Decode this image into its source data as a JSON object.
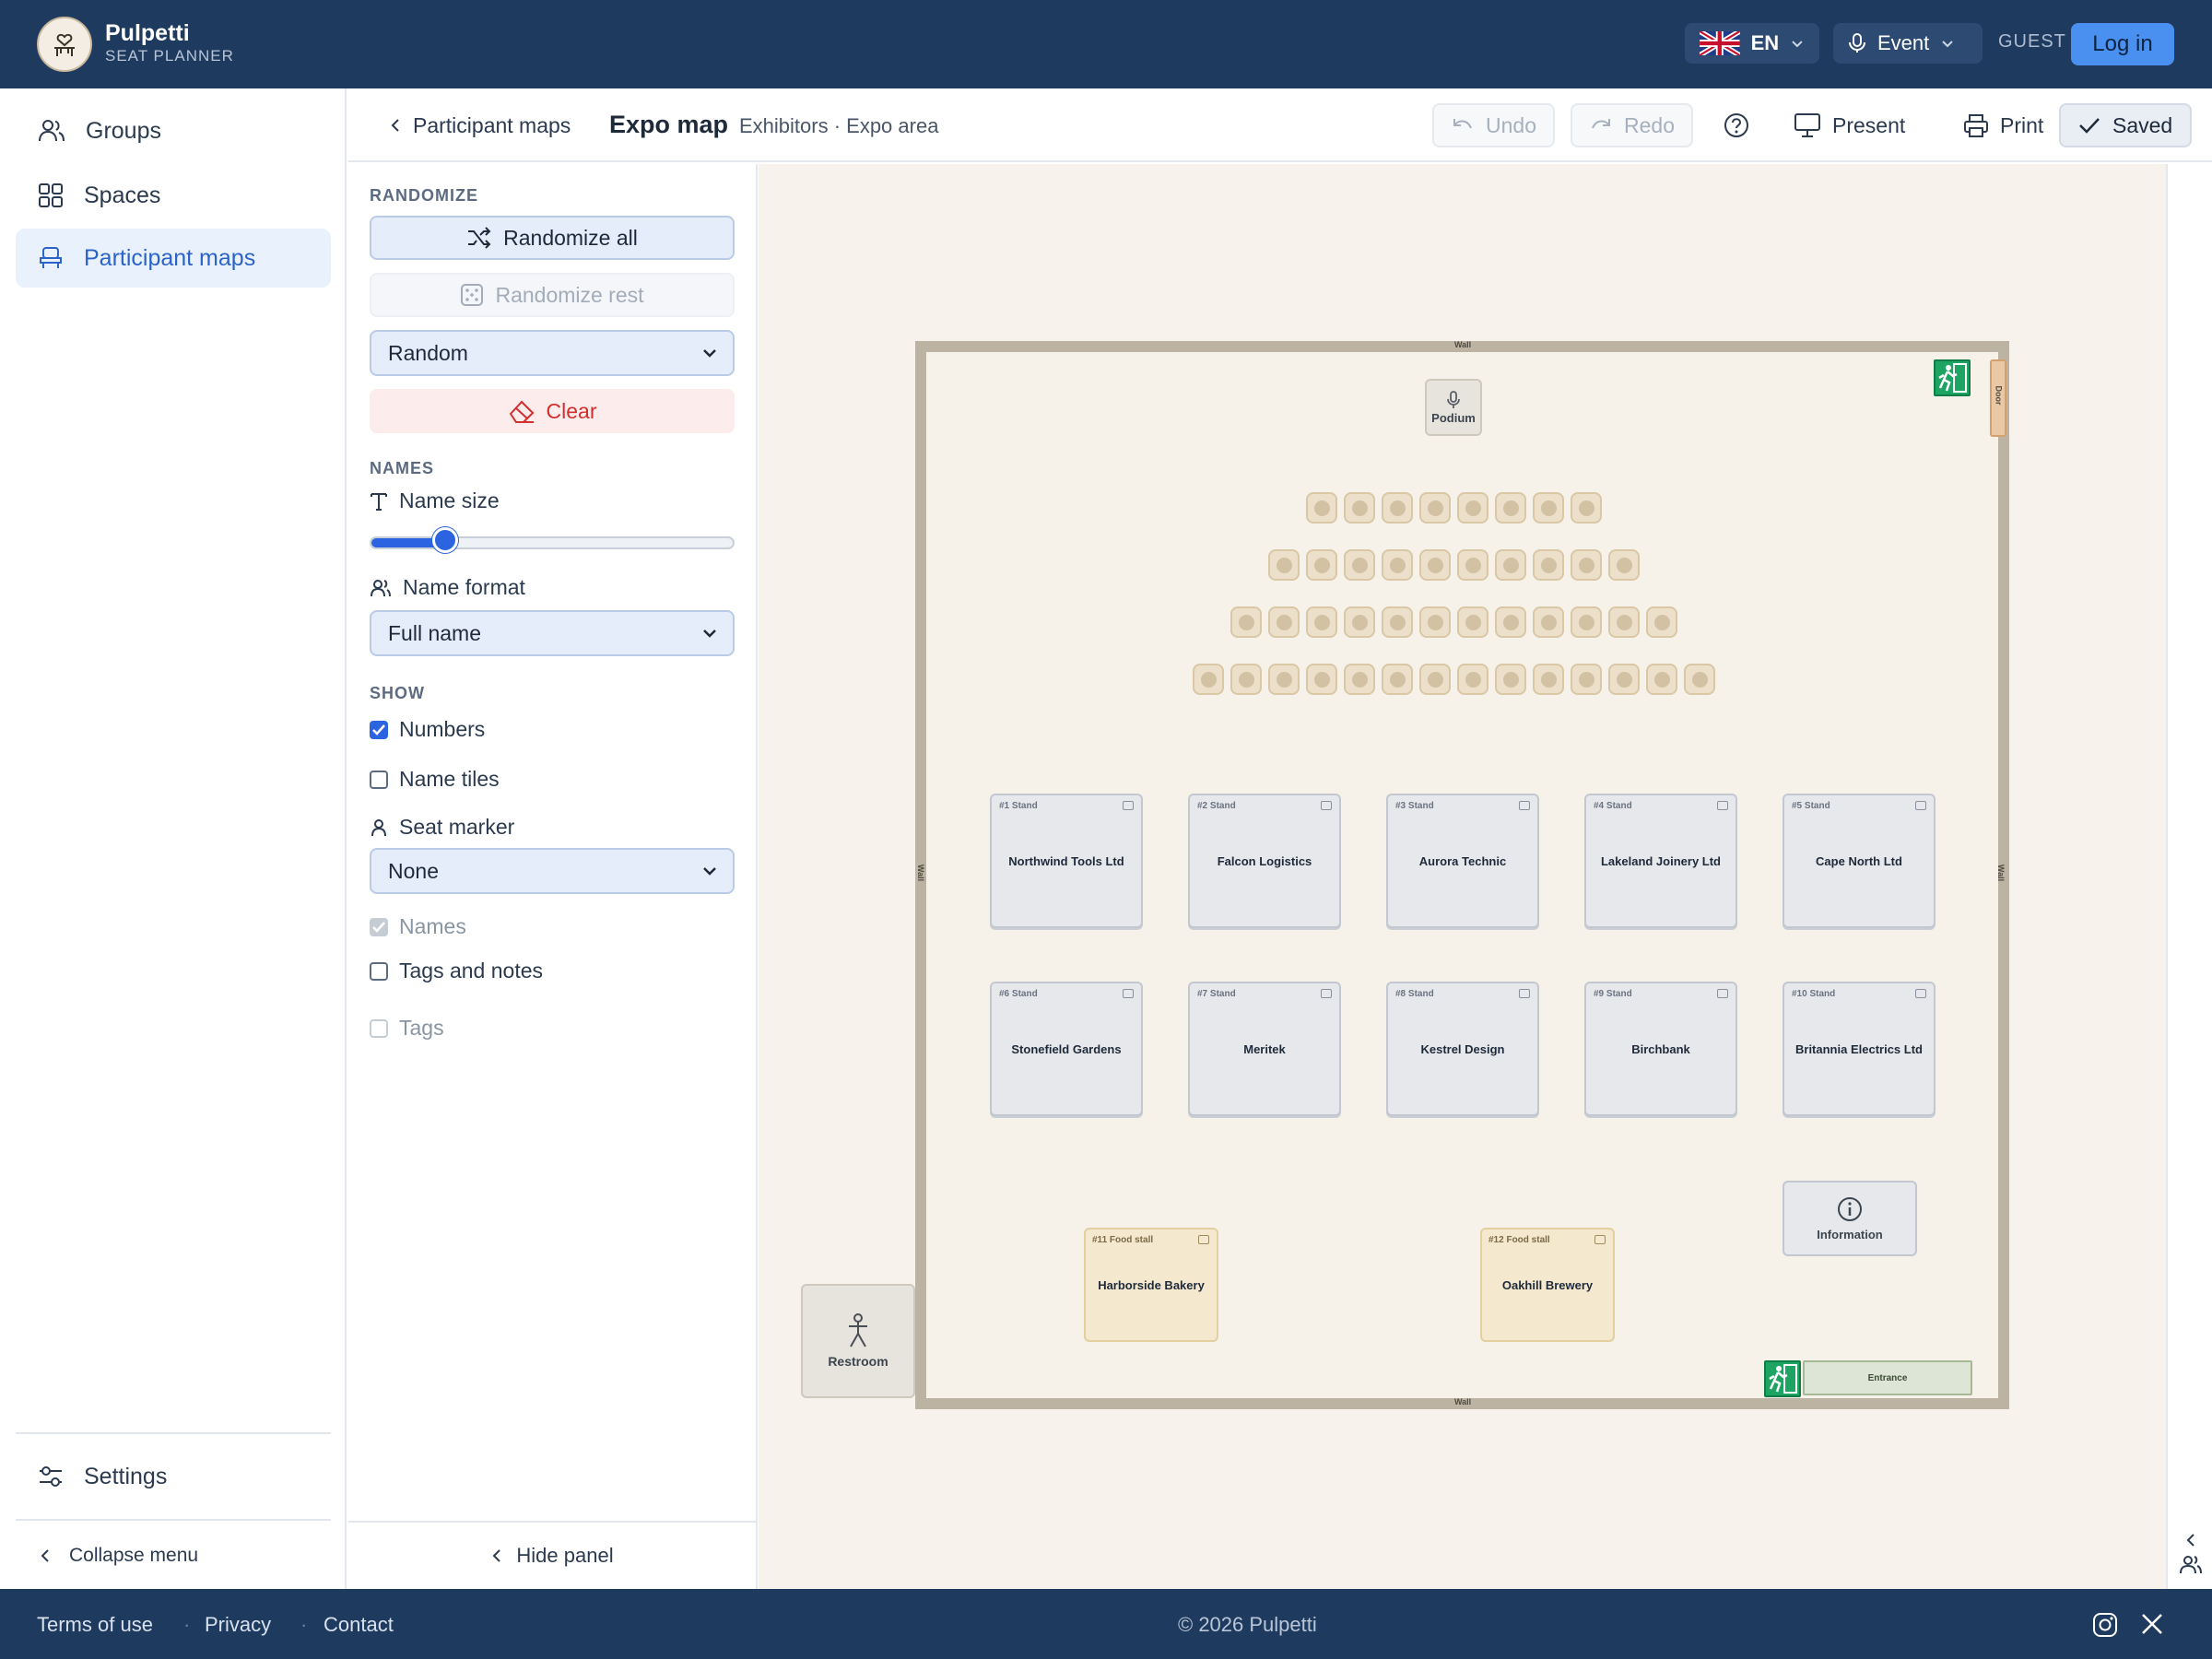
{
  "app": {
    "name": "Pulpetti",
    "subtitle": "SEAT PLANNER"
  },
  "topbar": {
    "language": "EN",
    "mode": "Event",
    "guest": "GUEST",
    "login": "Log in"
  },
  "nav": {
    "items": [
      {
        "label": "Groups",
        "icon": "users-icon"
      },
      {
        "label": "Spaces",
        "icon": "grid-icon"
      },
      {
        "label": "Participant maps",
        "icon": "seat-icon"
      }
    ],
    "settings": "Settings",
    "collapse": "Collapse menu"
  },
  "header": {
    "back": "Participant maps",
    "title": "Expo map",
    "subtitle": "Exhibitors · Expo area",
    "undo": "Undo",
    "redo": "Redo",
    "present": "Present",
    "print": "Print",
    "saved": "Saved"
  },
  "panel": {
    "randomize_title": "RANDOMIZE",
    "randomize_all": "Randomize all",
    "randomize_rest": "Randomize rest",
    "random_select": "Random",
    "clear": "Clear",
    "names_title": "NAMES",
    "name_size": "Name size",
    "name_size_value": 0.2,
    "name_format": "Name format",
    "name_format_value": "Full name",
    "show_title": "SHOW",
    "numbers": "Numbers",
    "name_tiles": "Name tiles",
    "seat_marker": "Seat marker",
    "seat_marker_value": "None",
    "names": "Names",
    "tags_and_notes": "Tags and notes",
    "tags": "Tags",
    "hide_panel": "Hide panel"
  },
  "map": {
    "wall": "Wall",
    "door": "Door",
    "podium": "Podium",
    "restroom": "Restroom",
    "information": "Information",
    "entrance": "Entrance",
    "seat_rows": [
      8,
      10,
      12,
      14
    ],
    "stands": [
      {
        "num": "#1 Stand",
        "name": "Northwind Tools Ltd"
      },
      {
        "num": "#2 Stand",
        "name": "Falcon Logistics"
      },
      {
        "num": "#3 Stand",
        "name": "Aurora Technic"
      },
      {
        "num": "#4 Stand",
        "name": "Lakeland Joinery Ltd"
      },
      {
        "num": "#5 Stand",
        "name": "Cape North Ltd"
      },
      {
        "num": "#6 Stand",
        "name": "Stonefield Gardens"
      },
      {
        "num": "#7 Stand",
        "name": "Meritek"
      },
      {
        "num": "#8 Stand",
        "name": "Kestrel Design"
      },
      {
        "num": "#9 Stand",
        "name": "Birchbank"
      },
      {
        "num": "#10 Stand",
        "name": "Britannia Electrics Ltd"
      }
    ],
    "food": [
      {
        "num": "#11 Food stall",
        "name": "Harborside Bakery"
      },
      {
        "num": "#12 Food stall",
        "name": "Oakhill Brewery"
      }
    ]
  },
  "footer": {
    "terms": "Terms of use",
    "privacy": "Privacy",
    "contact": "Contact",
    "copyright": "© 2026 Pulpetti"
  },
  "colors": {
    "navy": "#1f3a5f",
    "accent": "#2b63e0",
    "danger": "#d32f2f",
    "exit": "#1da462"
  }
}
